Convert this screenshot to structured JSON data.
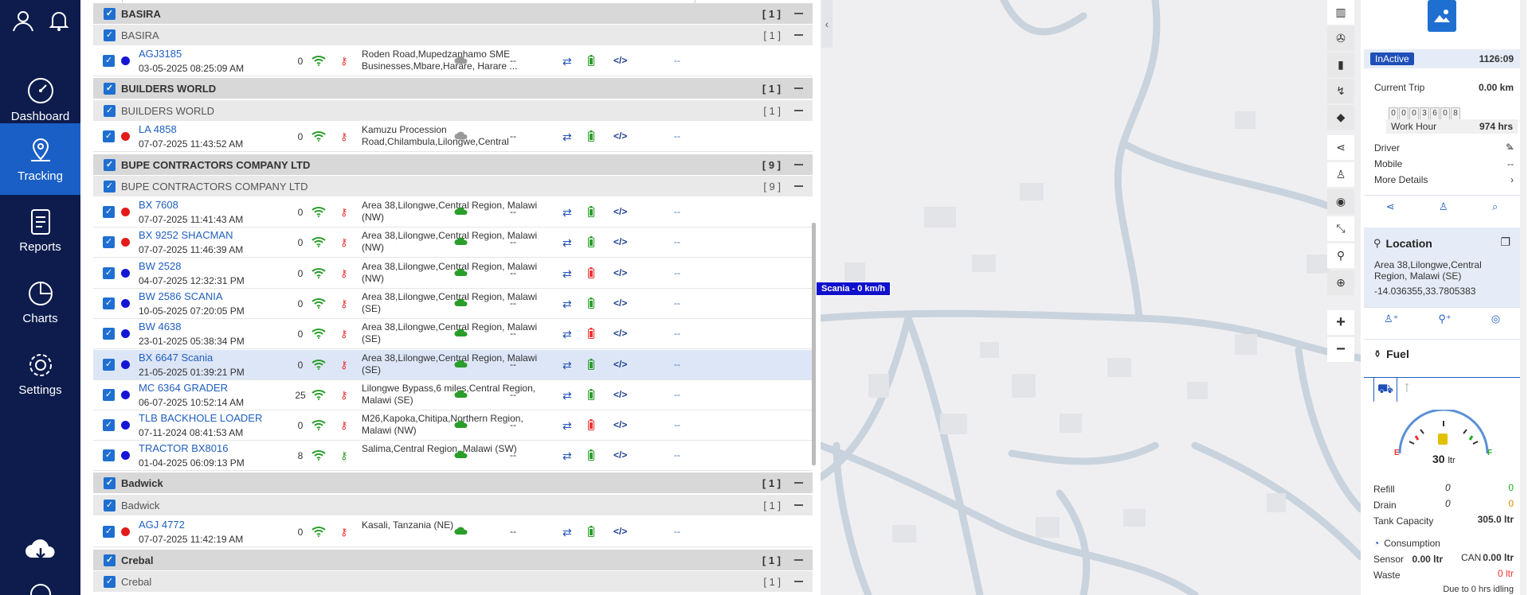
{
  "sidebar": {
    "items": [
      {
        "label": "Dashboard",
        "icon": "dashboard-gauge-icon"
      },
      {
        "label": "Tracking",
        "icon": "location-pin-icon"
      },
      {
        "label": "Reports",
        "icon": "document-icon"
      },
      {
        "label": "Charts",
        "icon": "pie-chart-icon"
      },
      {
        "label": "Settings",
        "icon": "gear-icon"
      }
    ]
  },
  "groups": {
    "basira": {
      "name": "BASIRA",
      "count": "[ 1 ]"
    },
    "basira_sub": {
      "name": "BASIRA",
      "count": "[ 1 ]"
    },
    "builders": {
      "name": "BUILDERS WORLD",
      "count": "[ 1 ]"
    },
    "builders_sub": {
      "name": "BUILDERS WORLD",
      "count": "[ 1 ]"
    },
    "bupe": {
      "name": "BUPE CONTRACTORS COMPANY LTD",
      "count": "[ 9 ]"
    },
    "bupe_sub": {
      "name": "BUPE CONTRACTORS COMPANY LTD",
      "count": "[ 9 ]"
    },
    "badwick": {
      "name": "Badwick",
      "count": "[ 1 ]"
    },
    "badwick_sub": {
      "name": "Badwick",
      "count": "[ 1 ]"
    },
    "crebal": {
      "name": "Crebal",
      "count": "[ 1 ]"
    },
    "crebal_sub": {
      "name": "Crebal",
      "count": "[ 1 ]"
    }
  },
  "vehicles": [
    {
      "name": "AGJ3185",
      "date": "03-05-2025 08:25:09 AM",
      "speed": "0",
      "address": "Roden Road,Mupedzanhamo SME Businesses,Mbare,Harare, Harare ...",
      "status": "blue",
      "sub": "--",
      "link": "--"
    },
    {
      "name": "LA 4858",
      "date": "07-07-2025 11:43:52 AM",
      "speed": "0",
      "address": "Kamuzu Procession Road,Chilambula,Lilongwe,Central",
      "status": "red",
      "sub": "--",
      "link": "--"
    },
    {
      "name": "BX 7608",
      "date": "07-07-2025 11:41:43 AM",
      "speed": "0",
      "address": "Area 38,Lilongwe,Central Region, Malawi (NW)",
      "status": "red",
      "sub": "--",
      "link": "--"
    },
    {
      "name": "BX 9252 SHACMAN",
      "date": "07-07-2025 11:46:39 AM",
      "speed": "0",
      "address": "Area 38,Lilongwe,Central Region, Malawi (NW)",
      "status": "red",
      "sub": "--",
      "link": "--"
    },
    {
      "name": "BW 2528",
      "date": "04-07-2025 12:32:31 PM",
      "speed": "0",
      "address": "Area 38,Lilongwe,Central Region, Malawi (NW)",
      "status": "blue",
      "sub": "--",
      "link": "--"
    },
    {
      "name": "BW 2586 SCANIA",
      "date": "10-05-2025 07:20:05 PM",
      "speed": "0",
      "address": "Area 38,Lilongwe,Central Region, Malawi (SE)",
      "status": "blue",
      "sub": "--",
      "link": "--"
    },
    {
      "name": "BW 4638",
      "date": "23-01-2025 05:38:34 PM",
      "speed": "0",
      "address": "Area 38,Lilongwe,Central Region, Malawi (SE)",
      "status": "blue",
      "sub": "--",
      "link": "--"
    },
    {
      "name": "BX 6647 Scania",
      "date": "21-05-2025 01:39:21 PM",
      "speed": "0",
      "address": "Area 38,Lilongwe,Central Region, Malawi (SE)",
      "status": "blue",
      "sub": "--",
      "link": "--"
    },
    {
      "name": "MC 6364 GRADER",
      "date": "06-07-2025 10:52:14 AM",
      "speed": "25",
      "address": "Lilongwe Bypass,6 miles,Central Region, Malawi (SE)",
      "status": "blue",
      "sub": "--",
      "link": "--"
    },
    {
      "name": "TLB BACKHOLE LOADER",
      "date": "07-11-2024 08:41:53 AM",
      "speed": "0",
      "address": "M26,Kapoka,Chitipa,Northern Region, Malawi (NW)",
      "status": "blue",
      "sub": "--",
      "link": "--"
    },
    {
      "name": "TRACTOR BX8016",
      "date": "01-04-2025 06:09:13 PM",
      "speed": "8",
      "address": "Salima,Central Region, Malawi (SW)",
      "status": "blue",
      "sub": "--",
      "link": "--"
    },
    {
      "name": "AGJ 4772",
      "date": "07-07-2025 11:42:19 AM",
      "speed": "0",
      "address": "Kasali, Tanzania (NE)",
      "status": "red",
      "sub": "--",
      "link": "--"
    }
  ],
  "map": {
    "label": "Scania - 0 km/h"
  },
  "detail": {
    "status": "InActive",
    "odometer": "1126:09",
    "current_trip_label": "Current Trip",
    "current_trip": "0.00 km",
    "digits": [
      "0",
      "0",
      "0",
      "3",
      "6",
      "0",
      "8"
    ],
    "work_hour_label": "Work Hour",
    "work_hour": "974 hrs",
    "driver_label": "Driver",
    "driver": "--",
    "mobile_label": "Mobile",
    "mobile": "--",
    "more_label": "More Details"
  },
  "location": {
    "title": "Location",
    "address": "Area 38,Lilongwe,Central Region, Malawi (SE)",
    "coords": "-14.036355,33.7805383"
  },
  "fuel": {
    "title": "Fuel",
    "gauge_value": "30",
    "gauge_unit": "ltr",
    "gauge_e": "E",
    "gauge_f": "F",
    "refill_label": "Refill",
    "refill_a": "0",
    "refill_b": "0",
    "drain_label": "Drain",
    "drain_a": "0",
    "drain_b": "0",
    "capacity_label": "Tank Capacity",
    "capacity": "305.0 ltr",
    "consumption_label": "Consumption",
    "sensor_label": "Sensor",
    "sensor": "0.00 ltr",
    "can_label": "CAN",
    "can": "0.00 ltr",
    "waste_label": "Waste",
    "waste": "0 ltr",
    "idle_note": "Due to 0 hrs idling"
  }
}
